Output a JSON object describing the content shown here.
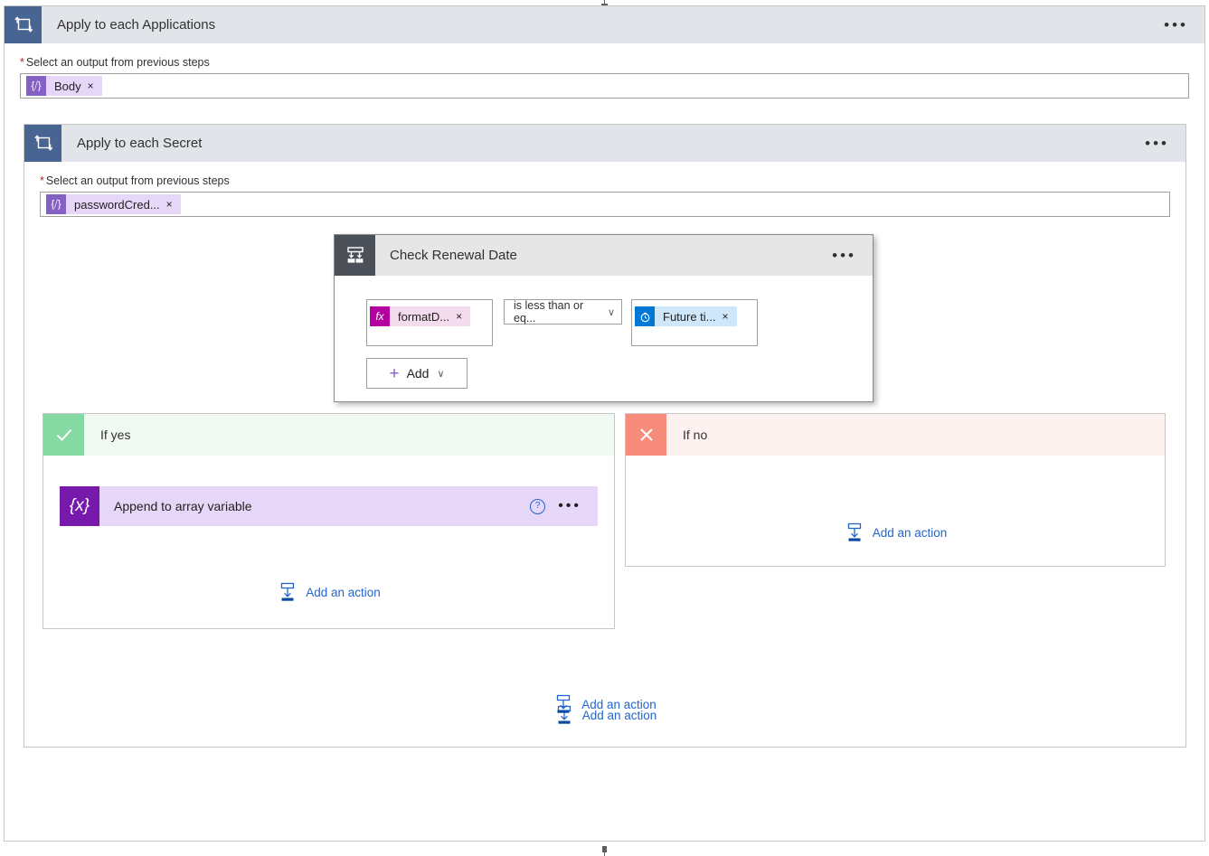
{
  "outer_loop": {
    "icon": "loop-icon",
    "title": "Apply to each Applications",
    "overflow": "•••",
    "field": {
      "required_marker": "*",
      "label": "Select an output from previous steps",
      "token": {
        "icon": "expression-braces-icon",
        "icon_glyph": "{⧸}",
        "label": "Body",
        "remove": "×"
      }
    }
  },
  "inner_loop": {
    "icon": "loop-icon",
    "title": "Apply to each Secret",
    "overflow": "•••",
    "field": {
      "required_marker": "*",
      "label": "Select an output from previous steps",
      "token": {
        "icon": "expression-braces-icon",
        "icon_glyph": "{⧸}",
        "label": "passwordCred...",
        "remove": "×"
      }
    }
  },
  "condition": {
    "icon": "condition-branch-icon",
    "title": "Check Renewal Date",
    "overflow": "•••",
    "left_operand": {
      "icon": "function-fx-icon",
      "icon_glyph": "fx",
      "label": "formatD...",
      "remove": "×"
    },
    "operator": {
      "value": "is less than or eq...",
      "chevron": "∨"
    },
    "right_operand": {
      "icon": "clock-icon",
      "icon_glyph": "⏱",
      "label": "Future ti...",
      "remove": "×"
    },
    "add_button": {
      "plus": "+",
      "label": "Add",
      "chevron": "∨"
    }
  },
  "branch_yes": {
    "icon": "checkmark-icon",
    "title": "If yes",
    "action": {
      "icon": "variable-braces-icon",
      "icon_glyph": "{x}",
      "title": "Append to array variable",
      "help": "?",
      "overflow": "•••"
    },
    "add_action_label": "Add an action"
  },
  "branch_no": {
    "icon": "close-x-icon",
    "title": "If no",
    "add_action_label": "Add an action"
  },
  "inner_add_action_label": "Add an action",
  "outer_add_action_label": "Add an action",
  "colors": {
    "loop_header_icon": "#486493",
    "loop_header_bg": "#e1e5ea",
    "condition_header_icon": "#4b5059",
    "condition_header_bg": "#e6e6e6",
    "yes_icon": "#85d9a2",
    "yes_bg": "#f0f9f2",
    "no_icon": "#f78b7c",
    "no_bg": "#fdf2f0",
    "variable_icon": "#7719aa",
    "variable_bg": "#e6d6f7",
    "token_icon": "#8661c5",
    "fx_icon": "#b4009e",
    "clock_icon": "#0078d4",
    "link_blue": "#2266cc",
    "required_red": "#a4262c"
  }
}
